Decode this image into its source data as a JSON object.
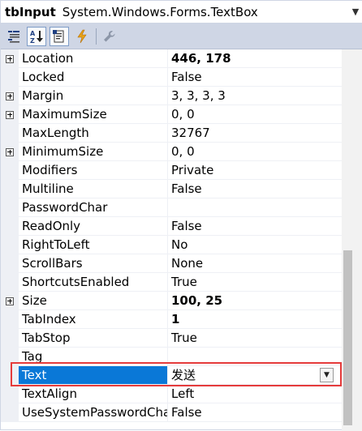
{
  "object_selector": {
    "name": "tbInput",
    "type": "System.Windows.Forms.TextBox"
  },
  "toolbar": {
    "buttons": [
      {
        "name": "categorized-icon",
        "active": false
      },
      {
        "name": "alphabetical-icon",
        "active": true
      },
      {
        "name": "properties-icon",
        "active": true
      },
      {
        "name": "events-icon",
        "active": false
      },
      {
        "name": "property-pages-icon",
        "active": false
      }
    ]
  },
  "properties": [
    {
      "name": "Location",
      "value": "446, 178",
      "expandable": true,
      "bold": true
    },
    {
      "name": "Locked",
      "value": "False",
      "expandable": false,
      "bold": false
    },
    {
      "name": "Margin",
      "value": "3, 3, 3, 3",
      "expandable": true,
      "bold": false
    },
    {
      "name": "MaximumSize",
      "value": "0, 0",
      "expandable": true,
      "bold": false
    },
    {
      "name": "MaxLength",
      "value": "32767",
      "expandable": false,
      "bold": false
    },
    {
      "name": "MinimumSize",
      "value": "0, 0",
      "expandable": true,
      "bold": false
    },
    {
      "name": "Modifiers",
      "value": "Private",
      "expandable": false,
      "bold": false
    },
    {
      "name": "Multiline",
      "value": "False",
      "expandable": false,
      "bold": false
    },
    {
      "name": "PasswordChar",
      "value": "",
      "expandable": false,
      "bold": false
    },
    {
      "name": "ReadOnly",
      "value": "False",
      "expandable": false,
      "bold": false
    },
    {
      "name": "RightToLeft",
      "value": "No",
      "expandable": false,
      "bold": false
    },
    {
      "name": "ScrollBars",
      "value": "None",
      "expandable": false,
      "bold": false
    },
    {
      "name": "ShortcutsEnabled",
      "value": "True",
      "expandable": false,
      "bold": false
    },
    {
      "name": "Size",
      "value": "100, 25",
      "expandable": true,
      "bold": true
    },
    {
      "name": "TabIndex",
      "value": "1",
      "expandable": false,
      "bold": true
    },
    {
      "name": "TabStop",
      "value": "True",
      "expandable": false,
      "bold": false
    },
    {
      "name": "Tag",
      "value": "",
      "expandable": false,
      "bold": false
    },
    {
      "name": "Text",
      "value": "发送",
      "expandable": false,
      "bold": false,
      "selected": true
    },
    {
      "name": "TextAlign",
      "value": "Left",
      "expandable": false,
      "bold": false
    },
    {
      "name": "UseSystemPasswordChar",
      "value": "False",
      "expandable": false,
      "bold": false
    }
  ],
  "colors": {
    "selection": "#0a78d7",
    "highlight_border": "#e53b3b",
    "toolbar_bg": "#cfd6e5"
  }
}
